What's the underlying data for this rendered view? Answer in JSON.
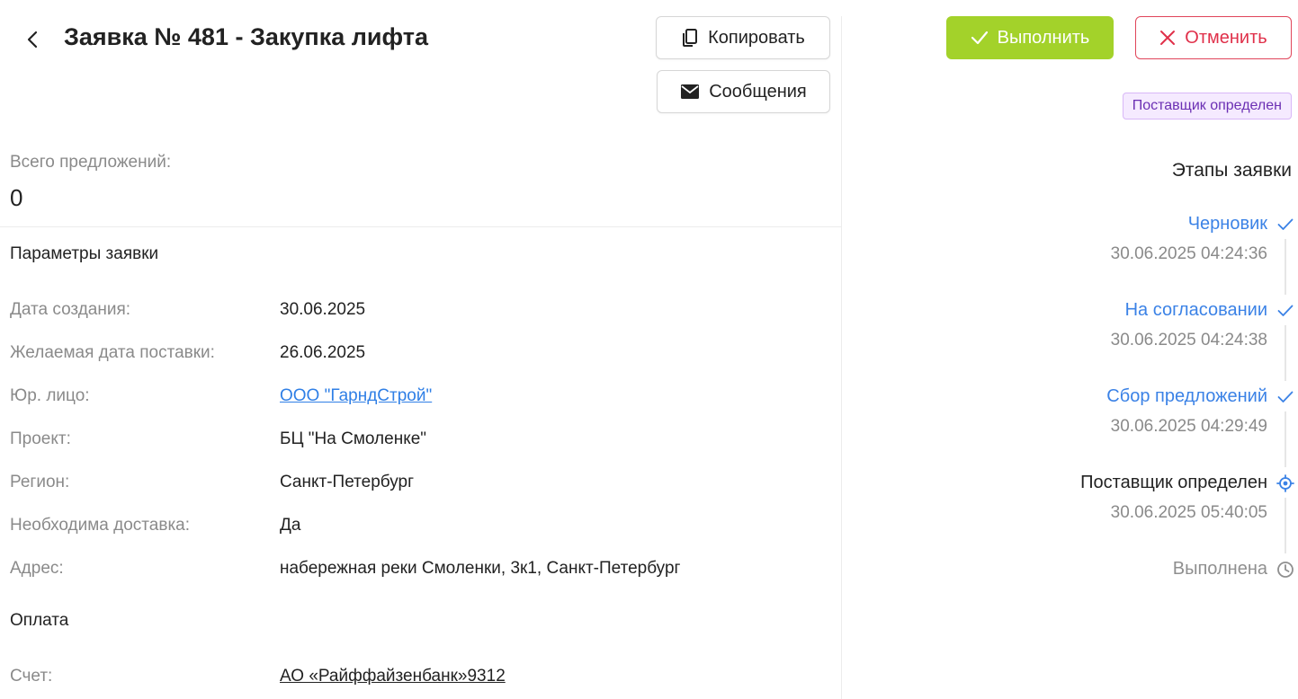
{
  "header": {
    "title": "Заявка № 481 - Закупка лифта",
    "copy_label": "Копировать",
    "messages_label": "Сообщения"
  },
  "offers": {
    "label": "Всего предложений:",
    "count": "0"
  },
  "params": {
    "title": "Параметры заявки",
    "rows": [
      {
        "label": "Дата создания:",
        "value": "30.06.2025"
      },
      {
        "label": "Желаемая дата поставки:",
        "value": "26.06.2025"
      },
      {
        "label": "Юр. лицо:",
        "value": "ООО \"ГарндСтрой\""
      },
      {
        "label": "Проект:",
        "value": "БЦ \"На Смоленке\""
      },
      {
        "label": "Регион:",
        "value": "Санкт-Петербург"
      },
      {
        "label": "Необходима доставка:",
        "value": "Да"
      },
      {
        "label": "Адрес:",
        "value": "набережная реки Смоленки, 3к1, Санкт-Петербург"
      }
    ]
  },
  "payment": {
    "title": "Оплата",
    "account_label": "Счет:",
    "account_value": "АО «Райффайзенбанк»9312"
  },
  "actions": {
    "execute_label": "Выполнить",
    "cancel_label": "Отменить"
  },
  "status": {
    "badge": "Поставщик определен"
  },
  "stages": {
    "title": "Этапы заявки",
    "items": [
      {
        "name": "Черновик",
        "date": "30.06.2025 04:24:36",
        "state": "done",
        "icon": "check-icon"
      },
      {
        "name": "На согласовании",
        "date": "30.06.2025 04:24:38",
        "state": "done",
        "icon": "check-icon"
      },
      {
        "name": "Сбор предложений",
        "date": "30.06.2025 04:29:49",
        "state": "done",
        "icon": "check-icon"
      },
      {
        "name": "Поставщик определен",
        "date": "30.06.2025 05:40:05",
        "state": "current",
        "icon": "target-icon"
      },
      {
        "name": "Выполнена",
        "date": "",
        "state": "pending",
        "icon": "clock-icon"
      }
    ]
  },
  "colors": {
    "accent_blue": "#3b82e6",
    "execute_green": "#a3d22a",
    "cancel_red": "#e0304a",
    "badge_purple": "#6b2fb3"
  }
}
